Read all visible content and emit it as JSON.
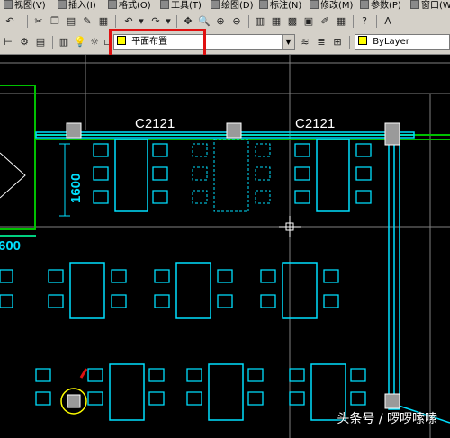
{
  "menu": [
    {
      "label": "视图(V)"
    },
    {
      "label": "插入(I)"
    },
    {
      "label": "格式(O)"
    },
    {
      "label": "工具(T)"
    },
    {
      "label": "绘图(D)"
    },
    {
      "label": "标注(N)"
    },
    {
      "label": "修改(M)"
    },
    {
      "label": "参数(P)"
    },
    {
      "label": "窗口(W)"
    }
  ],
  "layer_combo": {
    "value": "平面布置"
  },
  "linetype_combo": {
    "value": "ByLayer"
  },
  "drawing": {
    "window_label_left": "C2121",
    "window_label_right": "C2121",
    "dimension_vertical": "1600",
    "dimension_partial": "600"
  },
  "watermark": "头条号 / 啰啰嗦嗦",
  "colors": {
    "wall": "#00e0ff",
    "window": "#ffffff",
    "highlight": "#e01010",
    "grid": "#808080",
    "green": "#00c000"
  }
}
